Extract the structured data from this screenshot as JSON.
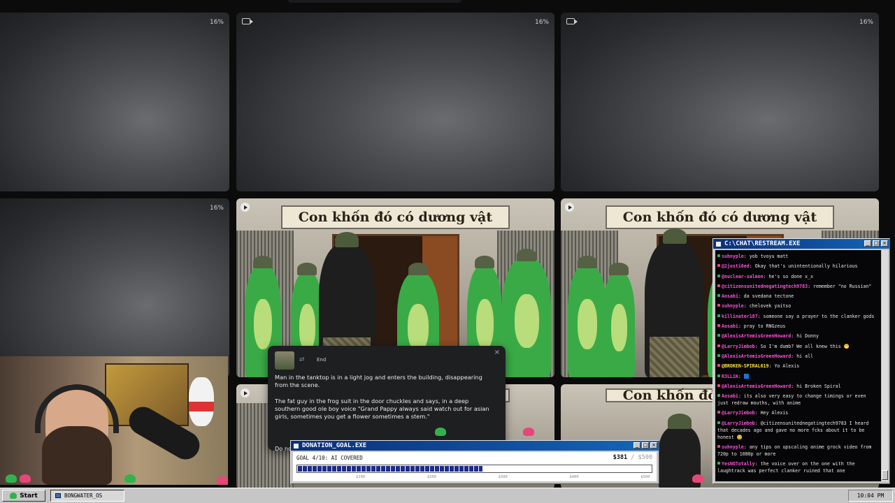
{
  "tiles": {
    "pct_label": "16%"
  },
  "scene": {
    "sign_text": "Con khốn đó có dương vật"
  },
  "caption": {
    "end_label": "End",
    "paragraphs": [
      "Man in the tanktop is in a light jog and enters the building, disappearing from the scene.",
      "The fat guy in the frog suit in the door chuckles and says, in a deep southern good ole boy voice \"Grand Pappy always said watch out for asian girls, sometimes you get a flower sometimes a stem.\"",
      "Do not"
    ]
  },
  "donation": {
    "title": "DONATION_GOAL.EXE",
    "goal_label": "GOAL 4/10: AI COVERED",
    "current": "$381",
    "separator": " / ",
    "target": "$500",
    "progress": 0.52,
    "ticks": [
      "$100 ",
      "$200",
      "$300",
      "$400",
      "$500"
    ],
    "window_buttons": [
      "_",
      "□",
      "×"
    ]
  },
  "chat": {
    "title": "C:\\CHAT\\RESTREAM.EXE",
    "window_buttons": [
      "_",
      "□",
      "×"
    ],
    "messages": [
      {
        "user": "suhnyple",
        "text": ": yob tvoyu matt",
        "color": "#ff4fd8",
        "dot": "#2fb34a"
      },
      {
        "user": "@2justi0ed",
        "text": ": Okay that's unintentionally hilarious",
        "color": "#ff4fd8",
        "dot": "#e8457a"
      },
      {
        "user": "@nuclear-salmon",
        "text": ": he's so done x_x",
        "color": "#ff4fd8",
        "dot": "#2fb34a"
      },
      {
        "user": "@citizensunitednegatingtech9783",
        "text": ": remember \"no Russian\"",
        "color": "#ff4fd8",
        "dot": "#e8457a"
      },
      {
        "user": "Aosabi",
        "text": ": da svedana tectone",
        "color": "#ff4fd8",
        "dot": "#2fb34a"
      },
      {
        "user": "suhnyple",
        "text": ": chelovek yaitso",
        "color": "#ff4fd8",
        "dot": "#e8457a"
      },
      {
        "user": "killinater187",
        "text": ": someone say a prayer to the clanker gods",
        "color": "#ff4fd8",
        "dot": "#2fb34a"
      },
      {
        "user": "Aosabi",
        "text": ": pray to RNGzeus",
        "color": "#ff4fd8",
        "dot": "#e8457a"
      },
      {
        "user": "@AlexisArtemisGreenHoward",
        "text": ": hi Donny",
        "color": "#ff4fd8",
        "dot": "#2fb34a"
      },
      {
        "user": "@LarryJimbob",
        "text": ": So I'm dumb? We all knew this 😁",
        "color": "#ff4fd8",
        "dot": "#e8457a"
      },
      {
        "user": "@AlexisArtemisGreenHoward",
        "text": ": hi all",
        "color": "#ff4fd8",
        "dot": "#2fb34a"
      },
      {
        "user": "@BROKEN-SPIRAL619",
        "text": ": Yo Alexis",
        "color": "#ffe23a",
        "dot": "#e8457a"
      },
      {
        "user": "R3LL1K",
        "text": ": 🟦",
        "color": "#ff4fd8",
        "dot": "#2fb34a"
      },
      {
        "user": "@AlexisArtemisGreenHoward",
        "text": ": hi Broken Spiral",
        "color": "#ff4fd8",
        "dot": "#e8457a"
      },
      {
        "user": "Aosabi",
        "text": ": its also very easy to change timings or even just redraw mouths, with anime",
        "color": "#ff4fd8",
        "dot": "#2fb34a"
      },
      {
        "user": "@LarryJimbob",
        "text": ": Hey Alexis",
        "color": "#ff4fd8",
        "dot": "#e8457a"
      },
      {
        "user": "@LarryJimbob",
        "text": ": @citizensunitednegatingtech9783 I heard that decades ago and gave no more fcks about it to be honest 😊",
        "color": "#ff4fd8",
        "dot": "#2fb34a"
      },
      {
        "user": "suhnyple",
        "text": ": any tips on upscaling anime grock video from 720p to 1080p or more",
        "color": "#ff4fd8",
        "dot": "#e8457a"
      },
      {
        "user": "YesNOTotally",
        "text": ": the voice over on the one with the laughtrack was perfect clanker ruined that one",
        "color": "#ff4fd8",
        "dot": "#2fb34a"
      }
    ]
  },
  "taskbar": {
    "start_label": "Start",
    "task_label": "BONGWATER_OS",
    "clock": "10:04 PM"
  },
  "colors": {
    "titlebar": "#0b2f7a",
    "progress_fill": "#1c2c8c",
    "frog_green": "#2fb34a"
  }
}
